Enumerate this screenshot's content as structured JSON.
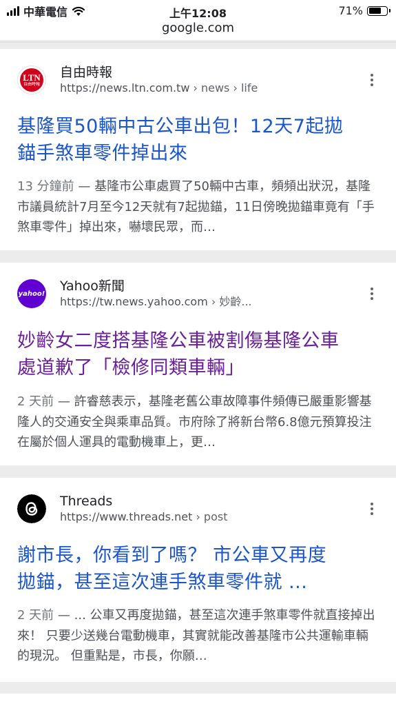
{
  "status_bar": {
    "carrier": "中華電信",
    "time": "上午12:08",
    "battery": "71%",
    "battery_level": 0.71
  },
  "address_bar": {
    "url": "google.com"
  },
  "results": [
    {
      "source_name": "自由時報",
      "logo_text": "LTN",
      "logo_subtext": "自由時報",
      "url": "https://news.ltn.com.tw",
      "breadcrumb": " › news › life",
      "title": "基隆買50輛中古公車出包！12天7起拋錨手煞車零件掉出來",
      "title_line1": "基隆買50輛中古公車出包！12天7起拋",
      "title_line2": "錨手煞車零件掉出來",
      "age": "13 分鐘前",
      "snippet": " — 基隆市公車處買了50輛中古車，頻頻出狀況，基隆市議員統計7月至今12天就有7起拋錨，11日傍晚拋錨車竟有「手煞車零件」掉出來，嚇壞民眾，而…",
      "visited": false
    },
    {
      "source_name": "Yahoo新聞",
      "logo_text": "yahoo!",
      "url": "https://tw.news.yahoo.com",
      "breadcrumb": " › 妙齡...",
      "title_line1": "妙齡女二度搭基隆公車被割傷基隆公車",
      "title_line2": "處道歉了「檢修同類車輛」",
      "age": "2 天前",
      "snippet": " — 許睿慈表示，基隆老舊公車故障事件頻傳已嚴重影響基隆人的交通安全與乘車品質。市府除了將新台幣6.8億元預算投注在屬於個人運具的電動機車上，更…",
      "visited": true
    },
    {
      "source_name": "Threads",
      "logo_text": "@",
      "url": "https://www.threads.net",
      "breadcrumb": " › post",
      "title_line1": "謝市長，你看到了嗎？ 市公車又再度",
      "title_line2": "拋錨，甚至這次連手煞車零件就 ...",
      "age": "2 天前",
      "snippet": " — ... 公車又再度拋錨，甚至這次連手煞車零件就直接掉出來！ 只要少送幾台電動機車，其實就能改善基隆市公共運輸車輛的現況。 但重點是，市長，你願…",
      "visited": false
    }
  ],
  "colors": {
    "link_blue": "#1a55c9",
    "visited_purple": "#6b1e9c",
    "page_gray": "#ececec"
  }
}
